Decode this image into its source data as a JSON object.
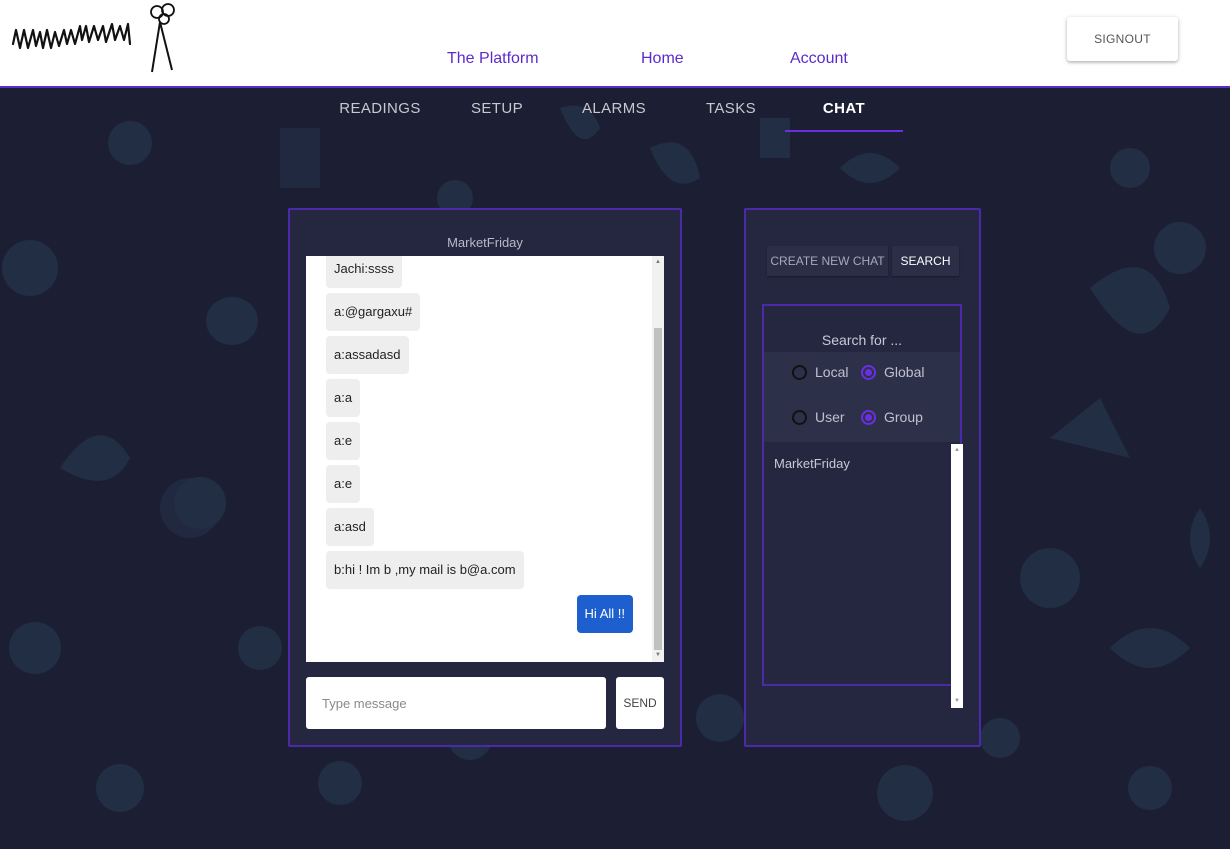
{
  "header": {
    "logo_text": "MWMANRUMA",
    "nav": [
      "The Platform",
      "Home",
      "Account"
    ],
    "signout_label": "SIGNOUT"
  },
  "tabs": [
    {
      "label": "READINGS",
      "active": false
    },
    {
      "label": "SETUP",
      "active": false
    },
    {
      "label": "ALARMS",
      "active": false
    },
    {
      "label": "TASKS",
      "active": false
    },
    {
      "label": "CHAT",
      "active": true
    }
  ],
  "chat": {
    "title": "MarketFriday",
    "messages": [
      {
        "text": "Jachi:ssss",
        "mine": false
      },
      {
        "text": "a:@gargaxu#",
        "mine": false
      },
      {
        "text": "a:assadasd",
        "mine": false
      },
      {
        "text": "a:a",
        "mine": false
      },
      {
        "text": "a:e",
        "mine": false
      },
      {
        "text": "a:e",
        "mine": false
      },
      {
        "text": "a:asd",
        "mine": false
      },
      {
        "text": "b:hi ! Im b ,my mail is b@a.com",
        "mine": false
      },
      {
        "text": "Hi All !!",
        "mine": true
      }
    ],
    "input_placeholder": "Type message",
    "input_value": "",
    "send_label": "SEND"
  },
  "side": {
    "create_label": "CREATE NEW CHAT",
    "search_label": "SEARCH",
    "search_for": "Search for ...",
    "options": [
      {
        "label": "Local",
        "checked": false
      },
      {
        "label": "Global",
        "checked": true
      },
      {
        "label": "User",
        "checked": false
      },
      {
        "label": "Group",
        "checked": true
      }
    ],
    "results": [
      "MarketFriday"
    ]
  },
  "colors": {
    "background": "#1c1f34",
    "panel": "#252741",
    "accent": "#6b2fe0",
    "nav_text": "#5b2bc9",
    "my_bubble": "#1d5fcf"
  }
}
